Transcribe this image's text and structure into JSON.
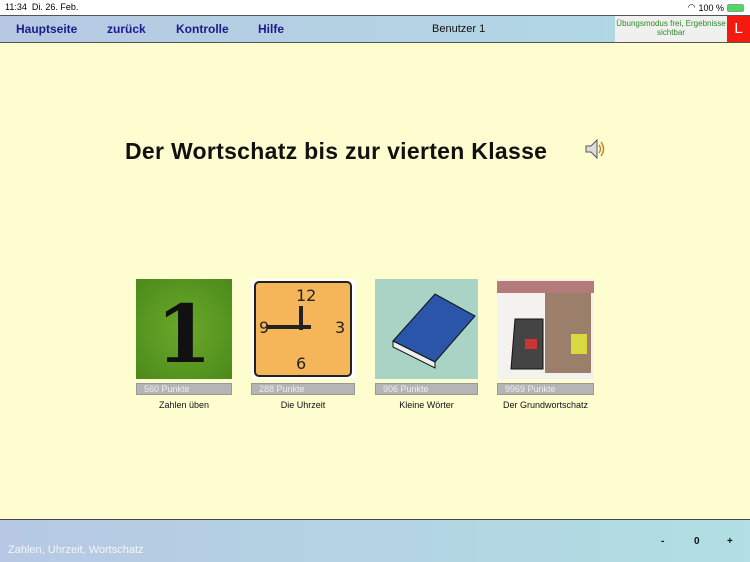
{
  "status": {
    "time": "11:34",
    "date": "Di. 26. Feb.",
    "battery": "100 %"
  },
  "topbar": {
    "nav": [
      "Hauptseite",
      "zurück",
      "Kontrolle",
      "Hilfe"
    ],
    "user": "Benutzer 1",
    "mode": "Übungsmodus frei, Ergebnisse sichtbar",
    "l_button": "L"
  },
  "main": {
    "title": "Der Wortschatz bis zur vierten Klasse",
    "tiles": [
      {
        "points": "560 Punkte",
        "label": "Zahlen üben",
        "image": "number-one"
      },
      {
        "points": "288 Punkte",
        "label": "Die Uhrzeit",
        "image": "clock"
      },
      {
        "points": "906 Punkte",
        "label": "Kleine Wörter",
        "image": "book"
      },
      {
        "points": "9969 Punkte",
        "label": "Der Grundwortschatz",
        "image": "library-chair"
      }
    ]
  },
  "bottom": {
    "text": "Zahlen, Uhrzeit, Wortschatz",
    "minus": "-",
    "value": "0",
    "plus": "+"
  },
  "colors": {
    "accent": "#1a1a8c",
    "red": "#f31a0f",
    "background": "#fefdd0"
  }
}
